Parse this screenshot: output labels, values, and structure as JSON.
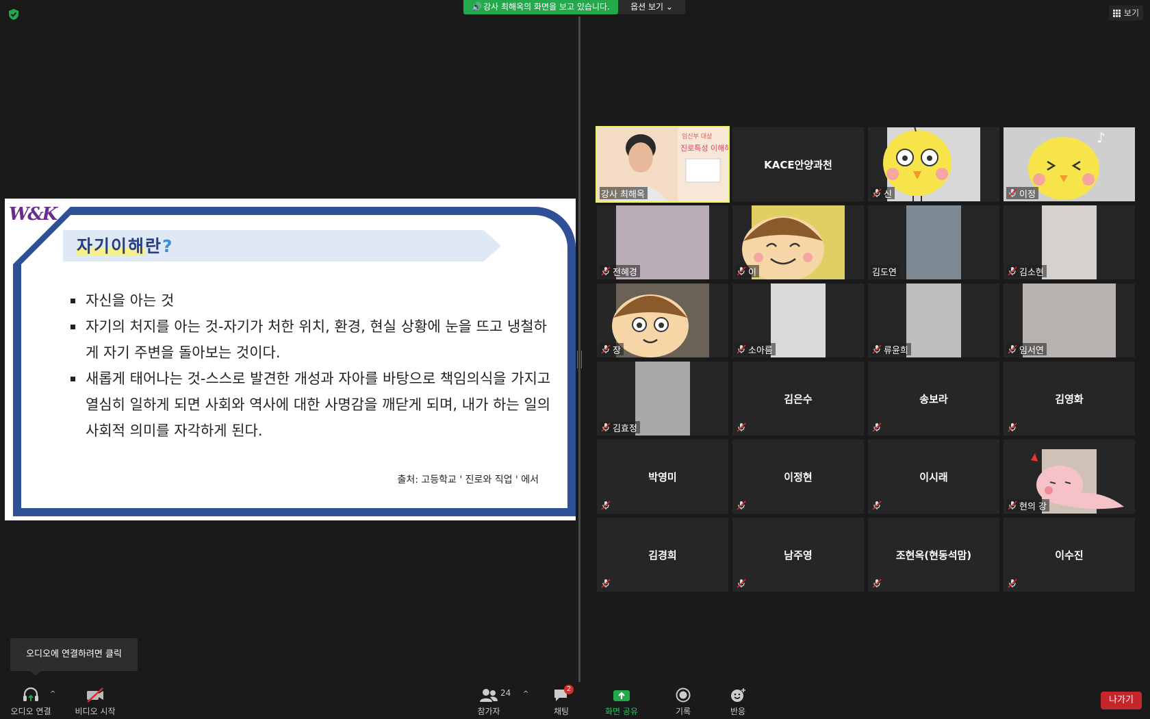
{
  "top": {
    "share_banner": "강사 최해옥의 화면을 보고 있습니다.",
    "options_label": "옵션 보기",
    "view_label": "보기"
  },
  "slide": {
    "logo": "W&K",
    "title_main": "자기이해",
    "title_end": "란",
    "title_q": "?",
    "bullets": [
      "자신을 아는 것",
      "자기의 처지를 아는 것-자기가 처한 위치, 환경, 현실 상황에 눈을 뜨고 냉철하게 자기 주변을 돌아보는 것이다.",
      "새롭게 태어나는 것-스스로 발견한 개성과 자아를 바탕으로 책임의식을 가지고 열심히 일하게 되면 사회와 역사에 대한 사명감을 깨닫게 되며, 내가 하는 일의 사회적 의미를 자각하게 된다."
    ],
    "source": "출처: 고등학교 ' 진로와 직업 ' 에서"
  },
  "participants": [
    {
      "name": "강사 최해옥",
      "type": "video",
      "active": true,
      "muted": false
    },
    {
      "name": "KACE안양과천",
      "type": "name",
      "muted": false
    },
    {
      "name": "신",
      "type": "video",
      "muted": true
    },
    {
      "name": "이정",
      "type": "video",
      "muted": true
    },
    {
      "name": "전혜경",
      "type": "video",
      "muted": true
    },
    {
      "name": "이",
      "type": "video",
      "muted": true
    },
    {
      "name": "김도연",
      "type": "video",
      "muted": false
    },
    {
      "name": "김소현",
      "type": "video",
      "muted": true
    },
    {
      "name": "장",
      "type": "video",
      "muted": true
    },
    {
      "name": "소아름",
      "type": "video",
      "muted": true
    },
    {
      "name": "류윤희",
      "type": "video",
      "muted": true
    },
    {
      "name": "임서연",
      "type": "video",
      "muted": true
    },
    {
      "name": "김효정",
      "type": "video",
      "muted": true
    },
    {
      "name": "김은수",
      "type": "name",
      "muted": true
    },
    {
      "name": "송보라",
      "type": "name",
      "muted": true
    },
    {
      "name": "김영화",
      "type": "name",
      "muted": true
    },
    {
      "name": "박영미",
      "type": "name",
      "muted": true
    },
    {
      "name": "이정현",
      "type": "name",
      "muted": true
    },
    {
      "name": "이시래",
      "type": "name",
      "muted": true
    },
    {
      "name": "현의 강",
      "type": "video",
      "muted": true
    },
    {
      "name": "김경희",
      "type": "name",
      "muted": true
    },
    {
      "name": "남주영",
      "type": "name",
      "muted": true
    },
    {
      "name": "조현옥(현동석맘)",
      "type": "name",
      "muted": true
    },
    {
      "name": "이수진",
      "type": "name",
      "muted": true
    }
  ],
  "toolbar": {
    "tooltip": "오디오에 연결하려면 클릭",
    "audio": "오디오 연결",
    "video": "비디오 시작",
    "participants": "참가자",
    "participants_count": "24",
    "chat": "채팅",
    "chat_badge": "2",
    "share": "화면 공유",
    "record": "기록",
    "reactions": "반응",
    "leave": "나가기"
  },
  "colors": {
    "banner_green": "#23a94c",
    "active_outline": "#e9f55b",
    "share_green": "#23a94c",
    "leave_red": "#c4262b",
    "slide_blue": "#2f4f96"
  }
}
